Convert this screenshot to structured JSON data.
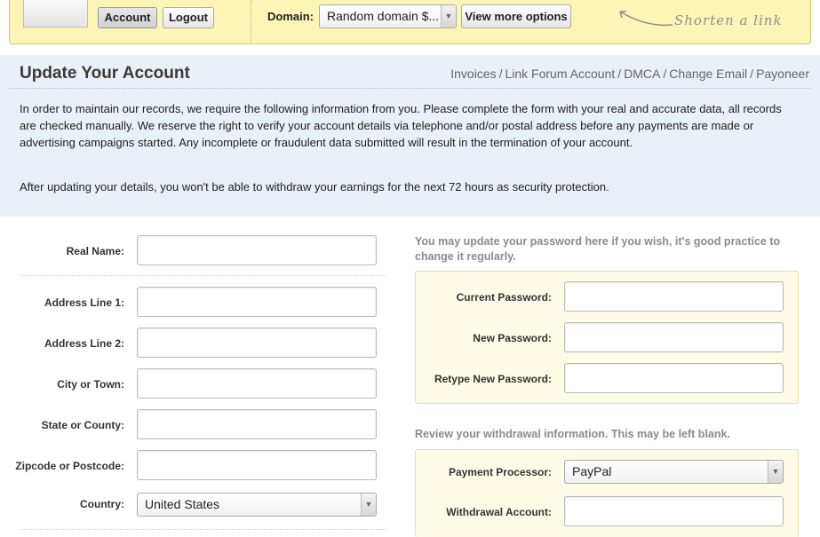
{
  "topbar": {
    "account_label": "Account",
    "logout_label": "Logout",
    "domain_label": "Domain:",
    "domain_value": "Random domain $...",
    "view_more_label": "View more options",
    "shorten_note": "Shorten a link"
  },
  "account": {
    "title": "Update Your Account",
    "nav": [
      "Invoices",
      "Link Forum Account",
      "DMCA",
      "Change Email",
      "Payoneer"
    ],
    "intro": "In order to maintain our records, we require the following information from you. Please complete the form with your real and accurate data, all records are checked manually. We reserve the right to verify your account details via telephone and/or postal address before any payments are made or advertising campaigns started. Any incomplete or fraudulent data submitted will result in the termination of your account.",
    "notice": "After updating your details, you won't be able to withdraw your earnings for the next 72 hours as security protection."
  },
  "form": {
    "real_name_label": "Real Name:",
    "address1_label": "Address Line 1:",
    "address2_label": "Address Line 2:",
    "city_label": "City or Town:",
    "state_label": "State or County:",
    "zip_label": "Zipcode or Postcode:",
    "country_label": "Country:",
    "country_value": "United States"
  },
  "password": {
    "note": "You may update your password here if you wish, it's good practice to change it regularly.",
    "current_label": "Current Password:",
    "new_label": "New Password:",
    "retype_label": "Retype New Password:"
  },
  "withdrawal": {
    "note": "Review your withdrawal information. This may be left blank.",
    "processor_label": "Payment Processor:",
    "processor_value": "PayPal",
    "account_label": "Withdrawal Account:"
  },
  "icons": {
    "dropdown_arrow": "chevron-down-icon"
  }
}
